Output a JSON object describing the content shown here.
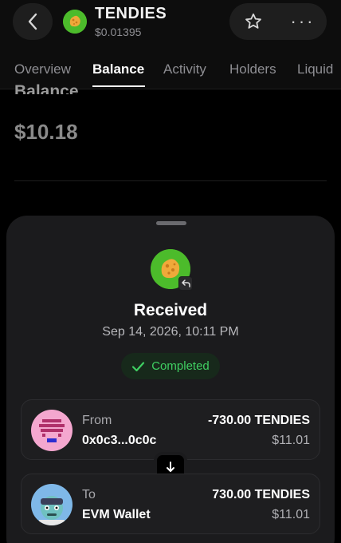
{
  "header": {
    "token_symbol": "TENDIES",
    "token_price": "$0.01395",
    "more_label": "···"
  },
  "tabs": [
    {
      "label": "Overview"
    },
    {
      "label": "Balance"
    },
    {
      "label": "Activity"
    },
    {
      "label": "Holders"
    },
    {
      "label": "Liquid"
    }
  ],
  "balance_section": {
    "label": "Balance",
    "value": "$10.18"
  },
  "transaction": {
    "status_title": "Received",
    "date": "Sep 14, 2026, 10:11 PM",
    "status_badge": "Completed",
    "from": {
      "role": "From",
      "name": "0x0c3...0c0c",
      "amount": "-730.00 TENDIES",
      "usd": "$11.01"
    },
    "to": {
      "role": "To",
      "name": "EVM Wallet",
      "amount": "730.00 TENDIES",
      "usd": "$11.01"
    }
  },
  "colors": {
    "accent_green": "#3fcf62",
    "token_bg": "#4cbb2b",
    "sheet_bg": "#1b1b1d"
  }
}
